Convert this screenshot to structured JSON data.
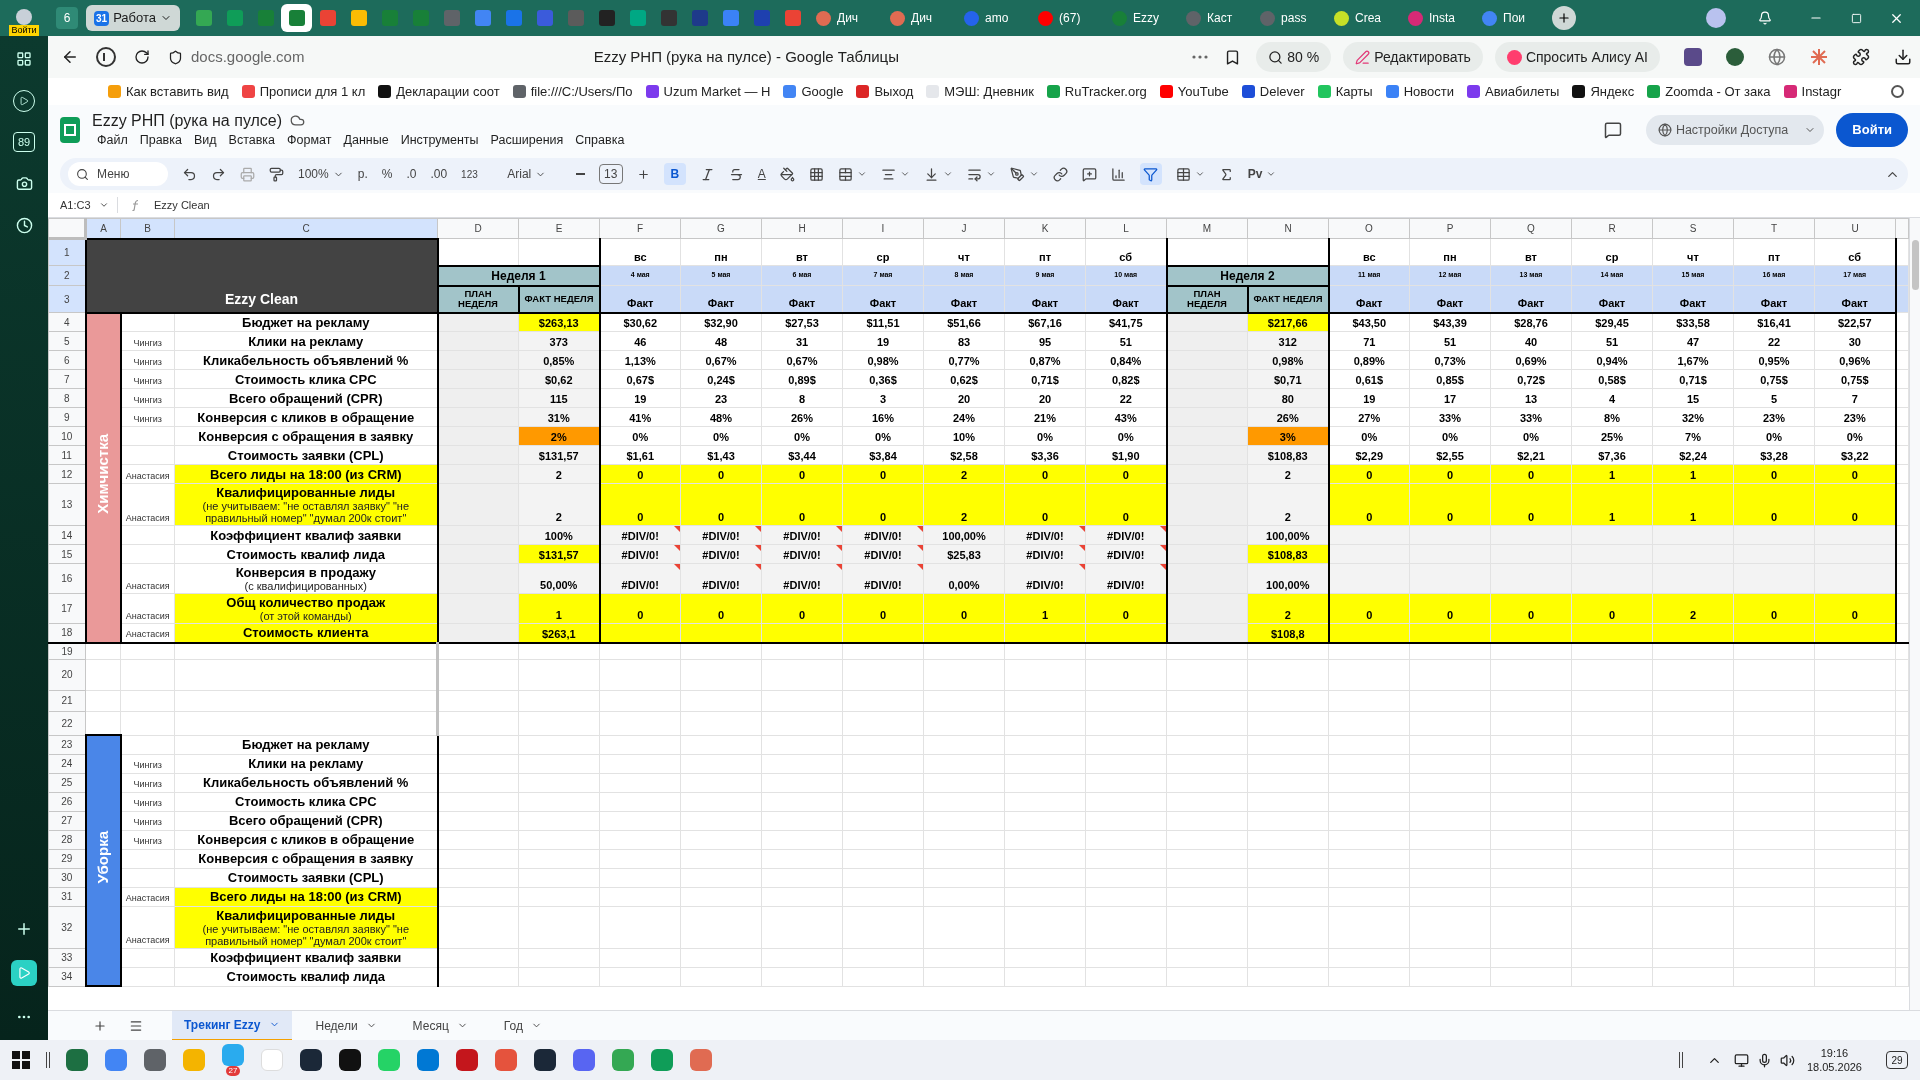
{
  "browser": {
    "profile": "Войти",
    "tab_count": "6",
    "group": {
      "number": "31",
      "label": "Работа"
    },
    "pinned_tabs": [
      {
        "selected": false
      },
      {
        "selected": false
      },
      {
        "selected": false
      },
      {
        "selected": true
      },
      {
        "selected": false
      },
      {
        "selected": false
      },
      {
        "selected": false
      },
      {
        "selected": false
      },
      {
        "selected": false
      },
      {
        "selected": false
      },
      {
        "selected": false
      },
      {
        "selected": false
      },
      {
        "selected": false
      },
      {
        "selected": false
      },
      {
        "selected": false
      },
      {
        "selected": false
      },
      {
        "selected": false
      },
      {
        "selected": false
      },
      {
        "selected": false
      },
      {
        "selected": false
      }
    ],
    "tabs": [
      {
        "label": "Дич",
        "selected": false
      },
      {
        "label": "Дич",
        "selected": false
      },
      {
        "label": "amo",
        "selected": false
      },
      {
        "label": "(67)",
        "selected": false
      },
      {
        "label": "Ezzy",
        "selected": false
      },
      {
        "label": "Каст",
        "selected": false
      },
      {
        "label": "pass",
        "selected": false
      },
      {
        "label": "Crea",
        "selected": false
      },
      {
        "label": "Insta",
        "selected": false
      },
      {
        "label": "Пои",
        "selected": false
      }
    ],
    "url": "docs.google.com",
    "page_title": "Ezzy РНП (рука на пулсе) - Google Таблицы",
    "zoom": "80 %",
    "edit": "Редактировать",
    "ask": "Спросить Алису AI",
    "bookmarks": [
      "Как вставить вид",
      "Прописи для 1 кл",
      "Декларации соот",
      "file:///C:/Users/По",
      "Uzum Market — Н",
      "Google",
      "Выход",
      "МЭШ: Дневник",
      "RuTracker.org",
      "YouTube",
      "Delever",
      "Карты",
      "Новости",
      "Авиабилеты",
      "Яндекс",
      "Zoomda - От зака",
      "Instagr"
    ],
    "sidebar_badge": "89"
  },
  "doc": {
    "title": "Ezzy РНП (рука на пулсе)",
    "menu": [
      "Файл",
      "Правка",
      "Вид",
      "Вставка",
      "Формат",
      "Данные",
      "Инструменты",
      "Расширения",
      "Справка"
    ],
    "access": "Настройки Доступа",
    "login": "Войти"
  },
  "toolbar": {
    "search": "Меню",
    "zoom": "100%",
    "currency": "р.",
    "percent": "%",
    "dec_less": ".0",
    "dec_more": ".00",
    "number_format": "123",
    "font": "Arial",
    "size": "13",
    "bold_label": "B",
    "text_color": "A",
    "bold": true,
    "filter": true,
    "input_tool": "Pv"
  },
  "formula_bar": {
    "cell": "A1:C3",
    "value": "Ezzy Clean"
  },
  "sheet": {
    "columns": [
      {
        "letter": "A",
        "selected": true
      },
      {
        "letter": "B",
        "selected": true
      },
      {
        "letter": "C",
        "selected": true
      },
      {
        "letter": "D",
        "selected": false
      },
      {
        "letter": "E",
        "selected": false
      },
      {
        "letter": "F",
        "selected": false
      },
      {
        "letter": "G",
        "selected": false
      },
      {
        "letter": "H",
        "selected": false
      },
      {
        "letter": "I",
        "selected": false
      },
      {
        "letter": "J",
        "selected": false
      },
      {
        "letter": "K",
        "selected": false
      },
      {
        "letter": "L",
        "selected": false
      },
      {
        "letter": "M",
        "selected": false
      },
      {
        "letter": "N",
        "selected": false
      },
      {
        "letter": "O",
        "selected": false
      },
      {
        "letter": "P",
        "selected": false
      },
      {
        "letter": "Q",
        "selected": false
      },
      {
        "letter": "R",
        "selected": false
      },
      {
        "letter": "S",
        "selected": false
      },
      {
        "letter": "T",
        "selected": false
      },
      {
        "letter": "U",
        "selected": false
      }
    ],
    "header_rows": [
      {
        "num": "1",
        "selected": true
      },
      {
        "num": "2",
        "selected": true
      },
      {
        "num": "3",
        "selected": true
      }
    ],
    "title": "Ezzy Clean",
    "weeks": [
      {
        "label": "Неделя 1",
        "plan": "ПЛАН НЕДЕЛЯ",
        "fact": "ФАКТ НЕДЕЛЯ",
        "days": [
          {
            "weekday": "вс",
            "date": "4 мая",
            "head": "Факт"
          },
          {
            "weekday": "пн",
            "date": "5 мая",
            "head": "Факт"
          },
          {
            "weekday": "вт",
            "date": "6 мая",
            "head": "Факт"
          },
          {
            "weekday": "ср",
            "date": "7 мая",
            "head": "Факт"
          },
          {
            "weekday": "чт",
            "date": "8 мая",
            "head": "Факт"
          },
          {
            "weekday": "пт",
            "date": "9 мая",
            "head": "Факт"
          },
          {
            "weekday": "сб",
            "date": "10 мая",
            "head": "Факт"
          }
        ]
      },
      {
        "label": "Неделя 2",
        "plan": "ПЛАН НЕДЕЛЯ",
        "fact": "ФАКТ НЕДЕЛЯ",
        "days": [
          {
            "weekday": "вс",
            "date": "11 мая",
            "head": "Факт"
          },
          {
            "weekday": "пн",
            "date": "12 мая",
            "head": "Факт"
          },
          {
            "weekday": "вт",
            "date": "13 мая",
            "head": "Факт"
          },
          {
            "weekday": "ср",
            "date": "14 мая",
            "head": "Факт"
          },
          {
            "weekday": "чт",
            "date": "15 мая",
            "head": "Факт"
          },
          {
            "weekday": "пт",
            "date": "16 мая",
            "head": "Факт"
          },
          {
            "weekday": "сб",
            "date": "17 мая",
            "head": "Факт"
          }
        ]
      }
    ],
    "sections": [
      {
        "name": "Химчистка",
        "color": "#ea9999",
        "rows": [
          {
            "num": "4",
            "label": "Бюджет на рекламу",
            "weeks": [
              {
                "fact": {
                  "text": "$263,13",
                  "color": "#ffff00"
                },
                "days": [
                  "$30,62",
                  "$32,90",
                  "$27,53",
                  "$11,51",
                  "$51,66",
                  "$67,16",
                  "$41,75"
                ]
              },
              {
                "fact": {
                  "text": "$217,66",
                  "color": "#ffff00"
                },
                "days": [
                  "$43,50",
                  "$43,39",
                  "$28,76",
                  "$29,45",
                  "$33,58",
                  "$16,41",
                  "$22,57"
                ]
              }
            ]
          },
          {
            "num": "5",
            "owner": "Чингиз",
            "label": "Клики на рекламу",
            "weeks": [
              {
                "fact": "373",
                "days": [
                  "46",
                  "48",
                  "31",
                  "19",
                  "83",
                  "95",
                  "51"
                ]
              },
              {
                "fact": "312",
                "days": [
                  "71",
                  "51",
                  "40",
                  "51",
                  "47",
                  "22",
                  "30"
                ]
              }
            ]
          },
          {
            "num": "6",
            "owner": "Чингиз",
            "label": "Кликабельность объявлений %",
            "weeks": [
              {
                "fact": "0,85%",
                "days": [
                  "1,13%",
                  "0,67%",
                  "0,67%",
                  "0,98%",
                  "0,77%",
                  "0,87%",
                  "0,84%"
                ]
              },
              {
                "fact": "0,98%",
                "days": [
                  "0,89%",
                  "0,73%",
                  "0,69%",
                  "0,94%",
                  "1,67%",
                  "0,95%",
                  "0,96%"
                ]
              }
            ]
          },
          {
            "num": "7",
            "owner": "Чингиз",
            "label": "Стоимость клика CPC",
            "weeks": [
              {
                "fact": "$0,62",
                "days": [
                  "0,67$",
                  "0,24$",
                  "0,89$",
                  "0,36$",
                  "0,62$",
                  "0,71$",
                  "0,82$"
                ]
              },
              {
                "fact": "$0,71",
                "days": [
                  "0,61$",
                  "0,85$",
                  "0,72$",
                  "0,58$",
                  "0,71$",
                  "0,75$",
                  "0,75$"
                ]
              }
            ]
          },
          {
            "num": "8",
            "owner": "Чингиз",
            "label": "Всего обращений (CPR)",
            "weeks": [
              {
                "fact": "115",
                "days": [
                  "19",
                  "23",
                  "8",
                  "3",
                  "20",
                  "20",
                  "22"
                ]
              },
              {
                "fact": "80",
                "days": [
                  "19",
                  "17",
                  "13",
                  "4",
                  "15",
                  "5",
                  "7"
                ]
              }
            ]
          },
          {
            "num": "9",
            "owner": "Чингиз",
            "label": "Конверсия с кликов в обращение",
            "weeks": [
              {
                "fact": "31%",
                "days": [
                  "41%",
                  "48%",
                  "26%",
                  "16%",
                  "24%",
                  "21%",
                  "43%"
                ]
              },
              {
                "fact": "26%",
                "days": [
                  "27%",
                  "33%",
                  "33%",
                  "8%",
                  "32%",
                  "23%",
                  "23%"
                ]
              }
            ]
          },
          {
            "num": "10",
            "label": "Конверсия с обращения в заявку",
            "weeks": [
              {
                "fact": {
                  "text": "2%",
                  "color": "#ff9900"
                },
                "days": [
                  "0%",
                  "0%",
                  "0%",
                  "0%",
                  "10%",
                  "0%",
                  "0%"
                ]
              },
              {
                "fact": {
                  "text": "3%",
                  "color": "#ff9900"
                },
                "days": [
                  "0%",
                  "0%",
                  "0%",
                  "25%",
                  "7%",
                  "0%",
                  "0%"
                ]
              }
            ]
          },
          {
            "num": "11",
            "label": "Стоимость заявки  (CPL)",
            "weeks": [
              {
                "fact": "$131,57",
                "days": [
                  "$1,61",
                  "$1,43",
                  "$3,44",
                  "$3,84",
                  "$2,58",
                  "$3,36",
                  "$1,90"
                ]
              },
              {
                "fact": "$108,83",
                "days": [
                  "$2,29",
                  "$2,55",
                  "$2,21",
                  "$7,36",
                  "$2,24",
                  "$3,28",
                  "$3,22"
                ]
              }
            ]
          },
          {
            "num": "12",
            "owner": "Анастасия",
            "label": "Всего лиды на 18:00 (из CRM)",
            "color": "#ffff00",
            "weeks": [
              {
                "fact": "2",
                "color": "#ffff00",
                "days": [
                  "0",
                  "0",
                  "0",
                  "0",
                  "2",
                  "0",
                  "0"
                ]
              },
              {
                "fact": "2",
                "color": "#ffff00",
                "days": [
                  "0",
                  "0",
                  "0",
                  "1",
                  "1",
                  "0",
                  "0"
                ]
              }
            ]
          },
          {
            "num": "13",
            "owner": "Анастасия",
            "label": "Квалифицированные лиды",
            "sublabel": "(не учитываем: \"не оставлял заявку\" \"не правильный номер\" \"думал 200к стоит\"",
            "color": "#ffff00",
            "weeks": [
              {
                "fact": "2",
                "color": "#ffff00",
                "days": [
                  "0",
                  "0",
                  "0",
                  "0",
                  "2",
                  "0",
                  "0"
                ]
              },
              {
                "fact": "2",
                "color": "#ffff00",
                "days": [
                  "0",
                  "0",
                  "0",
                  "1",
                  "1",
                  "0",
                  "0"
                ]
              }
            ]
          },
          {
            "num": "14",
            "label": "Коэффициент квалиф заявки",
            "weeks": [
              {
                "fact": "100%",
                "color": "#f3f3f3",
                "days": [
                  {
                    "text": "#DIV/0!",
                    "error": true
                  },
                  {
                    "text": "#DIV/0!",
                    "error": true
                  },
                  {
                    "text": "#DIV/0!",
                    "error": true
                  },
                  {
                    "text": "#DIV/0!",
                    "error": true
                  },
                  "100,00%",
                  {
                    "text": "#DIV/0!",
                    "error": true
                  },
                  {
                    "text": "#DIV/0!",
                    "error": true
                  }
                ]
              },
              {
                "fact": "100,00%",
                "color": "#f3f3f3"
              }
            ]
          },
          {
            "num": "15",
            "label": "Стоимость квалиф лида",
            "weeks": [
              {
                "fact": {
                  "text": "$131,57",
                  "color": "#ffff00"
                },
                "color": "#f3f3f3",
                "days": [
                  {
                    "text": "#DIV/0!",
                    "error": true
                  },
                  {
                    "text": "#DIV/0!",
                    "error": true
                  },
                  {
                    "text": "#DIV/0!",
                    "error": true
                  },
                  {
                    "text": "#DIV/0!",
                    "error": true
                  },
                  "$25,83",
                  {
                    "text": "#DIV/0!",
                    "error": true
                  },
                  {
                    "text": "#DIV/0!",
                    "error": true
                  }
                ]
              },
              {
                "fact": {
                  "text": "$108,83",
                  "color": "#ffff00"
                },
                "color": "#f3f3f3"
              }
            ]
          },
          {
            "num": "16",
            "owner": "Анастасия",
            "label": "Конверсия в продажу",
            "sublabel": "(с квалифицированных)",
            "weeks": [
              {
                "fact": "50,00%",
                "color": "#f3f3f3",
                "days": [
                  {
                    "text": "#DIV/0!",
                    "error": true
                  },
                  {
                    "text": "#DIV/0!",
                    "error": true
                  },
                  {
                    "text": "#DIV/0!",
                    "error": true
                  },
                  {
                    "text": "#DIV/0!",
                    "error": true
                  },
                  "0,00%",
                  {
                    "text": "#DIV/0!",
                    "error": true
                  },
                  {
                    "text": "#DIV/0!",
                    "error": true
                  }
                ]
              },
              {
                "fact": "100,00%",
                "color": "#f3f3f3"
              }
            ]
          },
          {
            "num": "17",
            "owner": "Анастасия",
            "label": "Общ количество продаж",
            "sublabel": "(от этой команды)",
            "color": "#ffff00",
            "weeks": [
              {
                "fact": {
                  "text": "1",
                  "color": "#ffff00"
                },
                "color": "#ffff00",
                "days": [
                  "0",
                  "0",
                  "0",
                  "0",
                  "0",
                  "1",
                  "0"
                ]
              },
              {
                "fact": {
                  "text": "2",
                  "color": "#ffff00"
                },
                "color": "#ffff00",
                "days": [
                  "0",
                  "0",
                  "0",
                  "0",
                  "2",
                  "0",
                  "0"
                ]
              }
            ]
          },
          {
            "num": "18",
            "owner": "Анастасия",
            "label": "Стоимость клиента",
            "color": "#ffff00",
            "weeks": [
              {
                "fact": {
                  "text": "$263,1",
                  "color": "#ffff00"
                },
                "color": "#ffff00"
              },
              {
                "fact": {
                  "text": "$108,8",
                  "color": "#ffff00"
                },
                "color": "#ffff00"
              }
            ]
          }
        ]
      },
      {
        "name": "Уборка",
        "color": "#4a86e8",
        "rows": [
          {
            "num": "23",
            "label": "Бюджет на рекламу"
          },
          {
            "num": "24",
            "owner": "Чингиз",
            "label": "Клики на рекламу"
          },
          {
            "num": "25",
            "owner": "Чингиз",
            "label": "Кликабельность объявлений %"
          },
          {
            "num": "26",
            "owner": "Чингиз",
            "label": "Стоимость клика CPC"
          },
          {
            "num": "27",
            "owner": "Чингиз",
            "label": "Всего обращений (CPR)"
          },
          {
            "num": "28",
            "owner": "Чингиз",
            "label": "Конверсия с кликов в обращение"
          },
          {
            "num": "29",
            "label": "Конверсия с обращения в заявку"
          },
          {
            "num": "30",
            "label": "Стоимость заявки  (CPL)"
          },
          {
            "num": "31",
            "owner": "Анастасия",
            "label": "Всего лиды на 18:00 (из CRM)",
            "color": "#ffff00"
          },
          {
            "num": "32",
            "owner": "Анастасия",
            "label": "Квалифицированные лиды",
            "sublabel": "(не учитываем: \"не оставлял заявку\" \"не правильный номер\" \"думал 200к стоит\"",
            "color": "#ffff00"
          },
          {
            "num": "33",
            "label": "Коэффициент квалиф заявки"
          },
          {
            "num": "34",
            "label": "Стоимость квалиф лида"
          }
        ]
      }
    ],
    "gap_rows": [
      "19",
      "20",
      "21",
      "22"
    ]
  },
  "sheet_tabs": [
    {
      "label": "Трекинг Ezzy",
      "selected": true
    },
    {
      "label": "Недели",
      "selected": false
    },
    {
      "label": "Месяц",
      "selected": false
    },
    {
      "label": "Год",
      "selected": false
    }
  ],
  "taskbar": {
    "badge": "27",
    "time": "19:16",
    "date": "18.05.2026",
    "notifications": "29"
  }
}
